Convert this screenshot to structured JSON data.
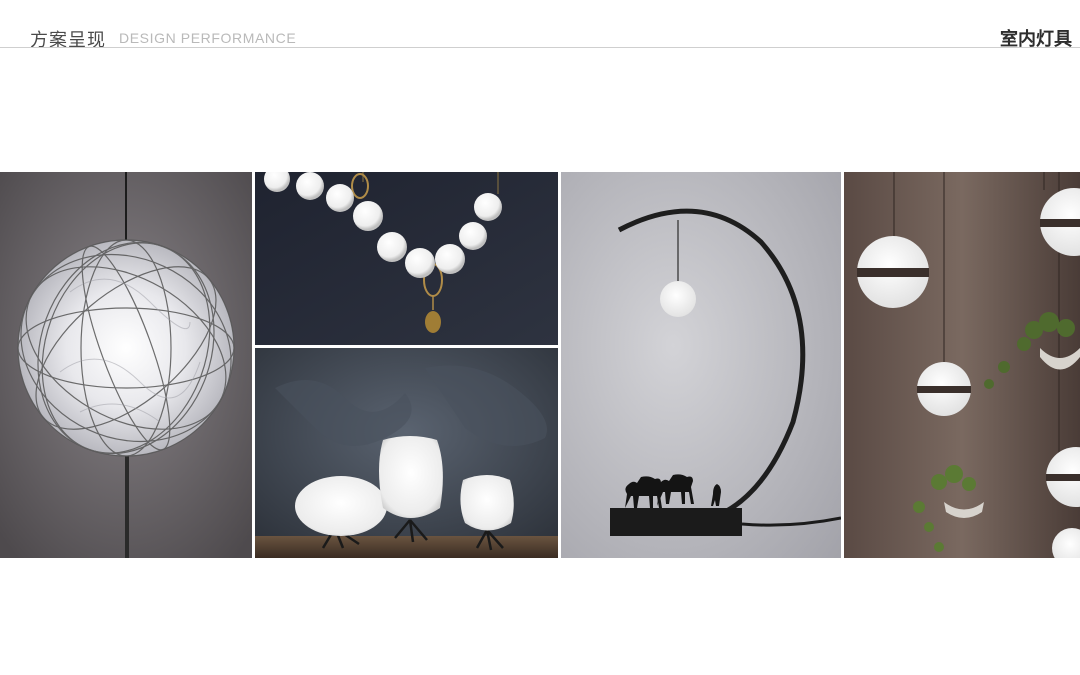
{
  "header": {
    "title_cn": "方案呈现",
    "title_en": "DESIGN PERFORMANCE",
    "category": "室内灯具"
  },
  "colors": {
    "rule": "#cfcfcf",
    "title_cn": "#4a4a4a",
    "title_en": "#b9b9b9",
    "category": "#2d2d2d"
  },
  "gallery": {
    "images": [
      "wire-ball-pendant-lamp",
      "pearl-necklace-chandelier",
      "glass-pebble-table-lamps",
      "crescent-moon-table-lamp-with-camels",
      "globe-pendants-with-planters"
    ]
  }
}
